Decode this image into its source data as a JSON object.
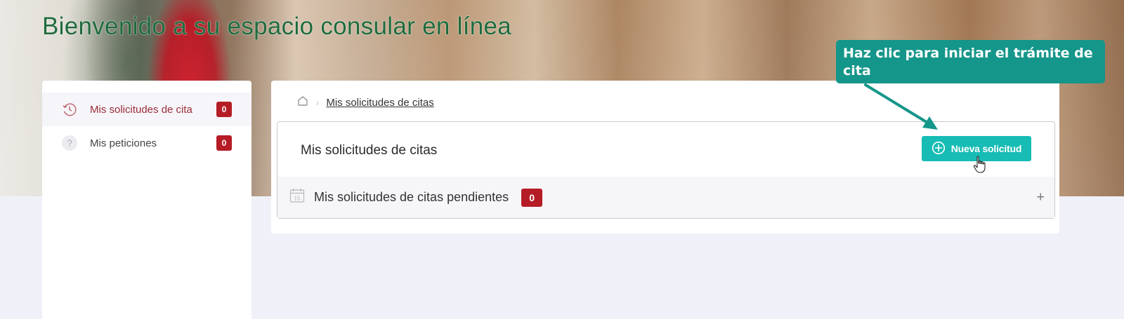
{
  "page": {
    "title": "Bienvenido a su espacio consular en línea"
  },
  "sidebar": {
    "items": [
      {
        "label": "Mis solicitudes de cita",
        "badge": "0",
        "icon": "clock-history-icon",
        "active": true
      },
      {
        "label": "Mis peticiones",
        "badge": "0",
        "icon": "question-circle-icon",
        "active": false
      }
    ]
  },
  "breadcrumb": {
    "home_icon": "home-icon",
    "current": "Mis solicitudes de citas"
  },
  "card": {
    "title": "Mis solicitudes de citas",
    "new_button": {
      "label": "Nueva solicitud",
      "icon": "plus-circle-icon"
    },
    "pending": {
      "label": "Mis solicitudes de citas pendientes",
      "badge": "0",
      "icon": "calendar-icon",
      "expand_icon": "plus-icon"
    }
  },
  "callout": {
    "text": "Haz clic para iniciar el trámite de cita"
  },
  "colors": {
    "title_green": "#1f6b3d",
    "accent_teal": "#17bcb4",
    "callout_teal": "#15968a",
    "badge_red": "#b51c26",
    "active_item": "#9b2d3a"
  }
}
